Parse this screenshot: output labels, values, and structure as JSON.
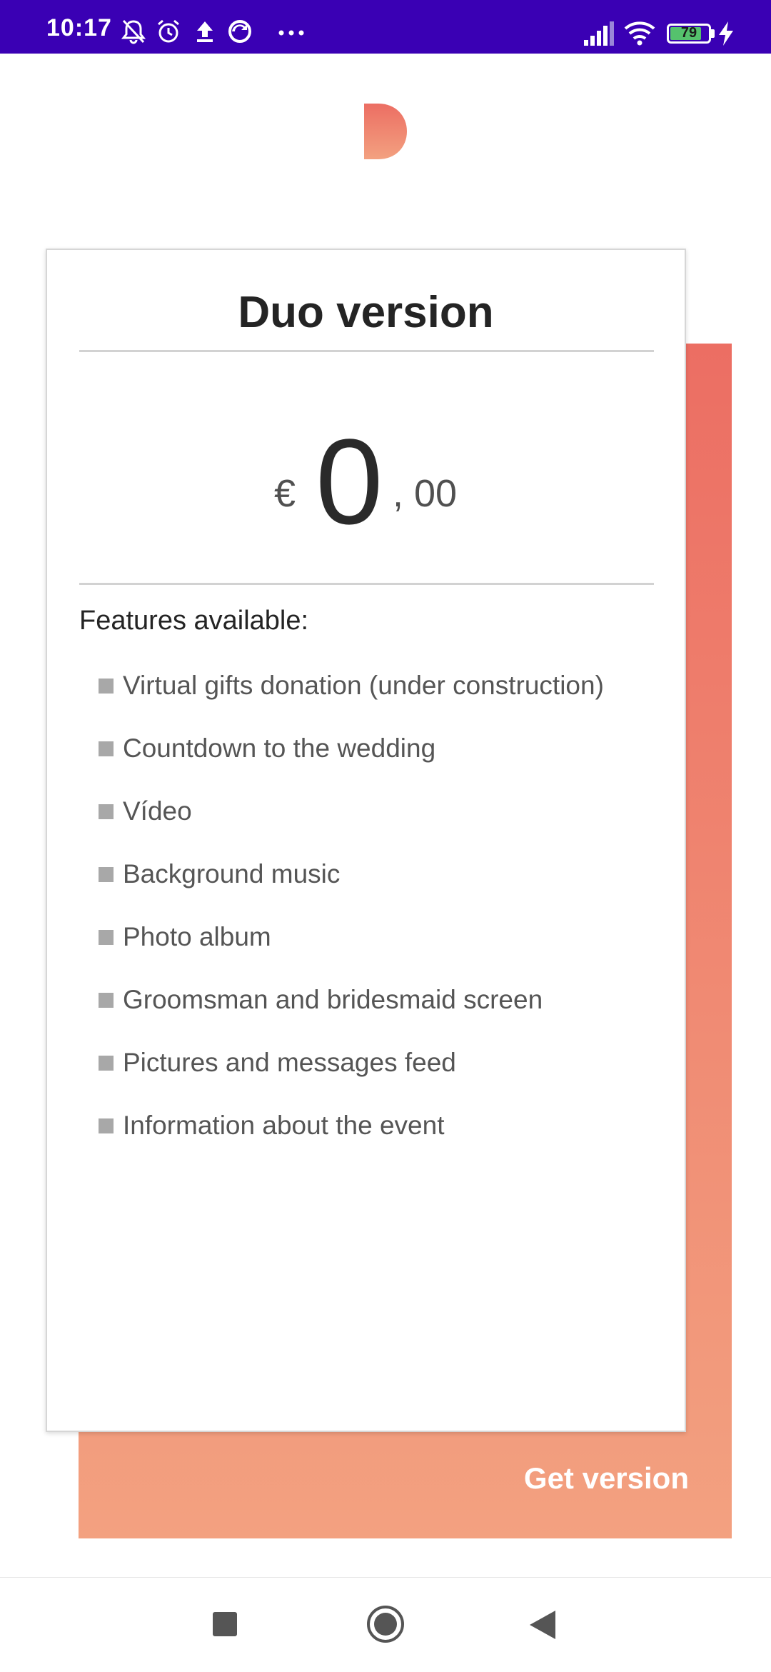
{
  "status_bar": {
    "time": "10:17",
    "battery_level": "79",
    "icons": [
      "bell-off-icon",
      "alarm-icon",
      "upload-icon",
      "sync-icon",
      "more-icon",
      "signal-icon",
      "wifi-icon",
      "battery-icon",
      "charging-icon"
    ]
  },
  "logo": {
    "icon": "app-logo-icon",
    "color": "#ef8a6e"
  },
  "card": {
    "title": "Duo version",
    "price": {
      "currency": "€",
      "whole": "0",
      "cents": ", 00"
    },
    "features_heading": "Features available:",
    "features": [
      "Virtual gifts donation (under construction)",
      "Countdown to the wedding",
      "Vídeo",
      "Background music",
      "Photo album",
      "Groomsman and bridesmaid screen",
      "Pictures and messages feed",
      "Information about the event"
    ]
  },
  "cta": {
    "label": "Get version"
  },
  "colors": {
    "status_bar": "#3a00b4",
    "gradient_top": "#ec6e63",
    "gradient_bottom": "#f3a180",
    "bullet": "#a8a8a8"
  },
  "nav_bar": {
    "icons": [
      "recent-apps-icon",
      "home-icon",
      "back-icon"
    ]
  }
}
